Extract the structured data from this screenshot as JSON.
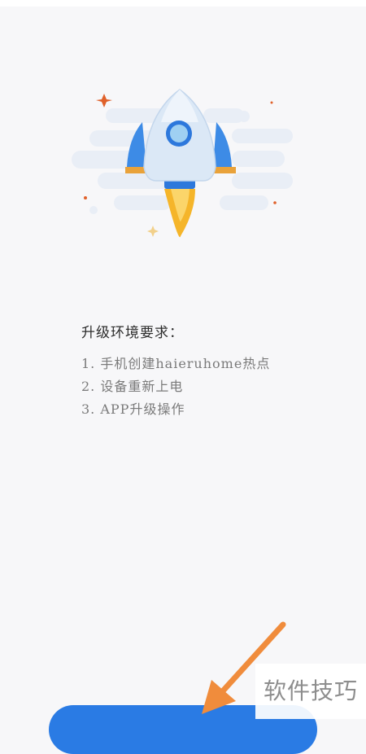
{
  "requirements": {
    "title": "升级环境要求：",
    "items": [
      "1. 手机创建haieruhome热点",
      "2. 设备重新上电",
      "3. APP升级操作"
    ]
  },
  "action_button": {
    "label": ""
  },
  "watermark": {
    "text": "软件技巧"
  },
  "colors": {
    "background": "#f7f7f9",
    "accent_blue": "#2a7be4",
    "rocket_body": "#dbe8f6",
    "rocket_fin": "#3d8be6",
    "flame": "#f5b52a",
    "arrow": "#f08c3c"
  },
  "icons": {
    "illustration": "rocket-illustration",
    "pointer": "arrow-pointer-icon"
  }
}
